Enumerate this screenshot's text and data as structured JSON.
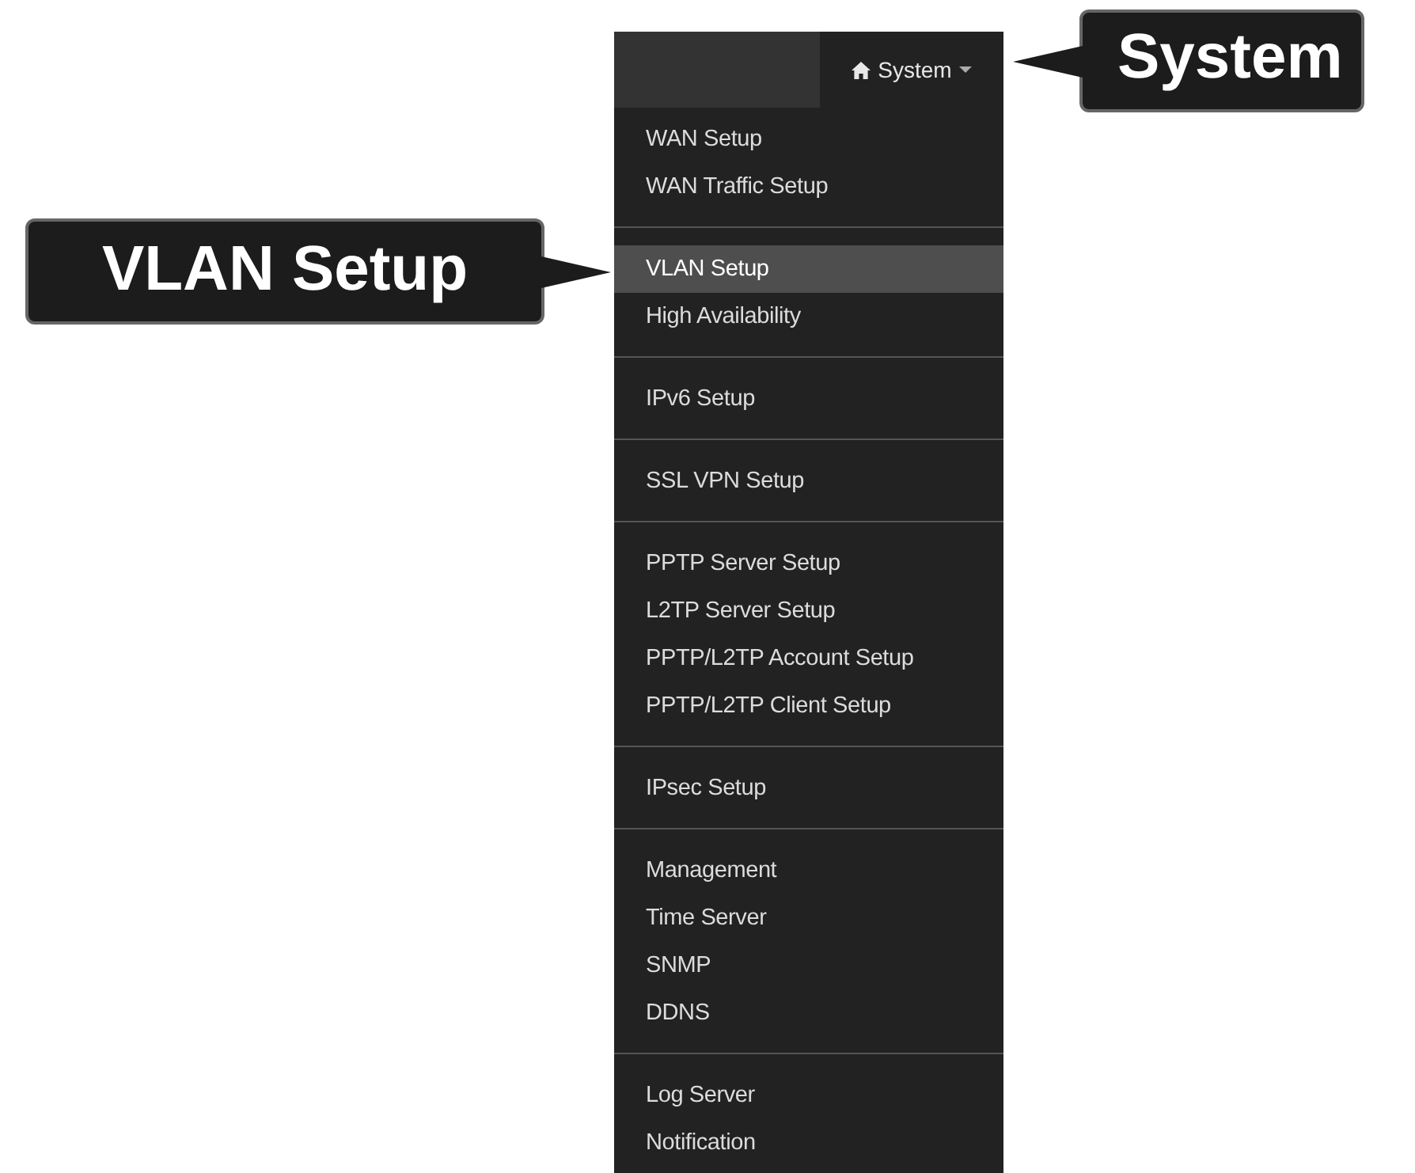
{
  "menu_button": {
    "label": "System"
  },
  "menu_groups": [
    {
      "items": [
        {
          "label": "WAN Setup",
          "selected": false
        },
        {
          "label": "WAN Traffic Setup",
          "selected": false
        }
      ]
    },
    {
      "items": [
        {
          "label": "VLAN Setup",
          "selected": true
        },
        {
          "label": "High Availability",
          "selected": false
        }
      ]
    },
    {
      "items": [
        {
          "label": "IPv6 Setup",
          "selected": false
        }
      ]
    },
    {
      "items": [
        {
          "label": "SSL VPN Setup",
          "selected": false
        }
      ]
    },
    {
      "items": [
        {
          "label": "PPTP Server Setup",
          "selected": false
        },
        {
          "label": "L2TP Server Setup",
          "selected": false
        },
        {
          "label": "PPTP/L2TP Account Setup",
          "selected": false
        },
        {
          "label": "PPTP/L2TP Client Setup",
          "selected": false
        }
      ]
    },
    {
      "items": [
        {
          "label": "IPsec Setup",
          "selected": false
        }
      ]
    },
    {
      "items": [
        {
          "label": "Management",
          "selected": false
        },
        {
          "label": "Time Server",
          "selected": false
        },
        {
          "label": "SNMP",
          "selected": false
        },
        {
          "label": "DDNS",
          "selected": false
        }
      ]
    },
    {
      "items": [
        {
          "label": "Log Server",
          "selected": false
        },
        {
          "label": "Notification",
          "selected": false
        }
      ]
    }
  ],
  "callouts": [
    {
      "kind": "header",
      "text": "System"
    },
    {
      "kind": "item",
      "text": "VLAN Setup"
    }
  ]
}
